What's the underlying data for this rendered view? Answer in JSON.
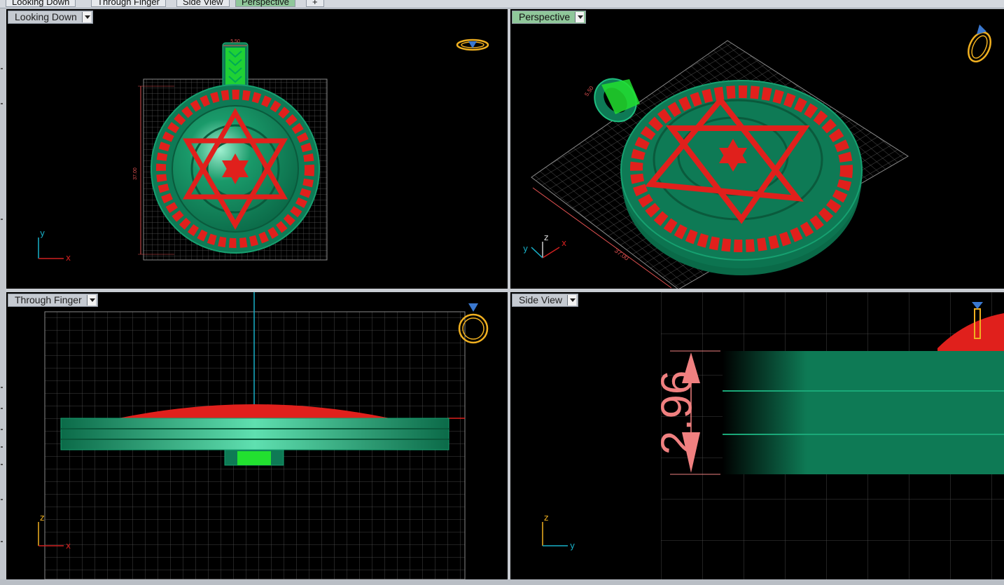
{
  "tabs": [
    "Looking Down",
    "Through Finger",
    "Side View",
    "Perspective",
    "+"
  ],
  "active_tab": "Perspective",
  "viewports": {
    "top_left": {
      "label": "Looking Down"
    },
    "top_right": {
      "label": "Perspective"
    },
    "bottom_left": {
      "label": "Through Finger"
    },
    "bottom_right": {
      "label": "Side View"
    }
  },
  "dimensions": {
    "bail_width": "5.50",
    "diameter": "37.00",
    "thickness": "2.96"
  },
  "axes": {
    "looking_down": [
      "y",
      "x"
    ],
    "perspective": [
      "y",
      "z",
      "x"
    ],
    "through_finger": [
      "z",
      "x"
    ],
    "side_view": [
      "z",
      "y"
    ]
  },
  "colors": {
    "metal": "#0e7a55",
    "engraving": "#e0201c",
    "bail_highlight": "#22e030",
    "grid": "#6a6a6a",
    "dimension_text": "#f08080",
    "ring_gizmo": "#f0b020",
    "background": "#000000"
  }
}
